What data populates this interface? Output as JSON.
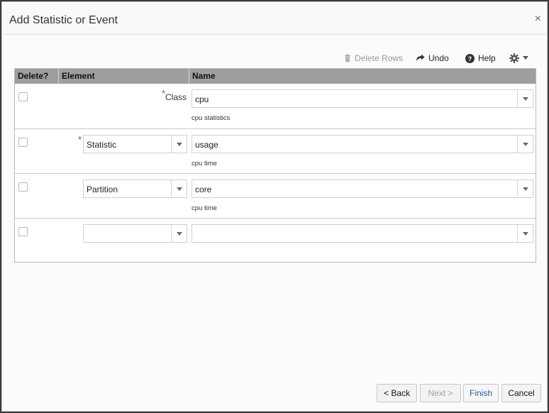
{
  "dialog": {
    "title": "Add Statistic or Event",
    "close_label": "×"
  },
  "toolbar": {
    "delete_rows": "Delete Rows",
    "undo": "Undo",
    "help": "Help"
  },
  "grid": {
    "headers": [
      "Delete?",
      "Element",
      "Name"
    ],
    "rows": [
      {
        "element_label": "Class",
        "element_value": "",
        "name_value": "cpu",
        "description": "cpu statistics"
      },
      {
        "element_label": "",
        "element_value": "Statistic",
        "name_value": "usage",
        "description": "cpu time"
      },
      {
        "element_label": "",
        "element_value": "Partition",
        "name_value": "core",
        "description": "cpu time"
      },
      {
        "element_label": "",
        "element_value": "",
        "name_value": "",
        "description": ""
      }
    ],
    "required_mark": "*"
  },
  "footer": {
    "back": "< Back",
    "next": "Next >",
    "finish": "Finish",
    "cancel": "Cancel"
  },
  "colors": {
    "header_bg": "#9e9e9e",
    "accent_required": "#1f6fb2",
    "finish_text": "#2f5f8f"
  },
  "icons": {
    "delete": "trash-icon",
    "undo": "undo-icon",
    "help": "help-icon",
    "settings": "gear-icon"
  }
}
